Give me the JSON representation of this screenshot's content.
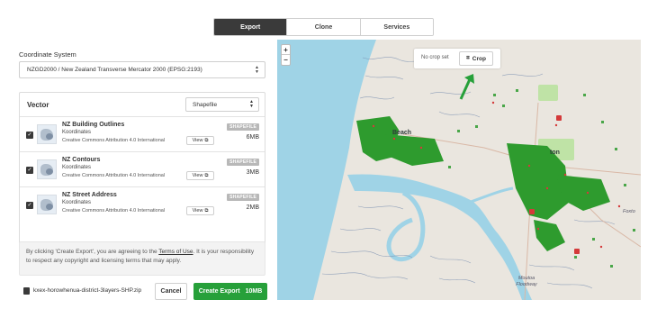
{
  "tabs": [
    {
      "label": "Export",
      "active": true
    },
    {
      "label": "Clone",
      "active": false
    },
    {
      "label": "Services",
      "active": false
    }
  ],
  "coordinate_system": {
    "label": "Coordinate System",
    "value": "NZGD2000 / New Zealand Transverse Mercator 2000 (EPSG:2193)"
  },
  "vector": {
    "heading": "Vector",
    "format": "Shapefile",
    "layers": [
      {
        "title": "NZ Building Outlines",
        "org": "Koordinates",
        "license": "Creative Commons Attribution 4.0 International",
        "view_label": "View",
        "badge": "SHAPEFILE",
        "size": "6MB"
      },
      {
        "title": "NZ Contours",
        "org": "Koordinates",
        "license": "Creative Commons Attribution 4.0 International",
        "view_label": "View",
        "badge": "SHAPEFILE",
        "size": "3MB"
      },
      {
        "title": "NZ Street Address",
        "org": "Koordinates",
        "license": "Creative Commons Attribution 4.0 International",
        "view_label": "View",
        "badge": "SHAPEFILE",
        "size": "2MB"
      }
    ]
  },
  "terms": {
    "before": "By clicking 'Create Export', you are agreeing to the ",
    "link": "Terms of Use",
    "after": ". It is your responsibility to respect any copyright and licensing terms that may apply."
  },
  "footer": {
    "filename": "kxex-horowhenua-district-3layers-SHP.zip",
    "cancel_label": "Cancel",
    "create_label": "Create Export",
    "create_size": "10MB"
  },
  "map": {
    "zoom_in": "+",
    "zoom_out": "−",
    "crop_status": "No crop set",
    "crop_label": "Crop",
    "place_beach": "Beach",
    "place_town": "ton",
    "place_flood": "Moutoa Floodway",
    "place_road": "Foxto",
    "colors": {
      "sea": "#9fd3e6",
      "land": "#eae6df",
      "buildings": "#2e9b2e",
      "crop_arrow": "#27a03a"
    }
  },
  "colors": {
    "accent": "#27a03a",
    "tab_active": "#3a3a3a"
  }
}
